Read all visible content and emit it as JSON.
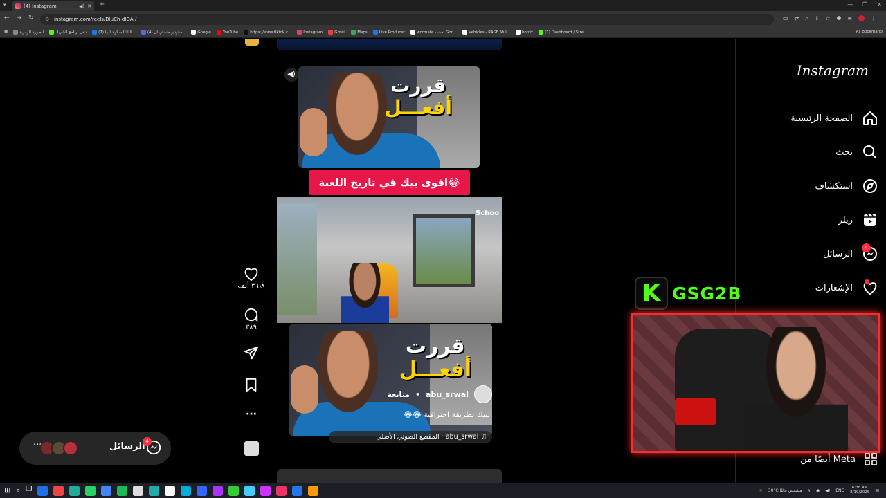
{
  "browser": {
    "tab_title": "(4) Instagram",
    "url": "instagram.com/reels/DluCh-dlQA-/",
    "bookmarks": [
      {
        "label": "الصورة الرمزية",
        "color": "#8a8a8a"
      },
      {
        "label": "دخل برنامج الشريك",
        "color": "#53fc18"
      },
      {
        "label": "(2) الباشا سكواد البيا...",
        "color": "#1877f2"
      },
      {
        "label": "(4) ستوديو منشئي ال...",
        "color": "#4a6cf7"
      },
      {
        "label": "Google",
        "color": "#ffffff"
      },
      {
        "label": "YouTube",
        "color": "#ff0000"
      },
      {
        "label": "https://www.tiktok.c...",
        "color": "#111111"
      },
      {
        "label": "Instagram",
        "color": "#e4405f"
      },
      {
        "label": "Gmail",
        "color": "#ea4335"
      },
      {
        "label": "Maps",
        "color": "#34a853"
      },
      {
        "label": "Live Producer",
        "color": "#1877f2"
      },
      {
        "label": "wormate - بحث Goo...",
        "color": "#ffffff"
      },
      {
        "label": "Vehicles - RAGE Mul...",
        "color": "#ffffff"
      },
      {
        "label": "botrix",
        "color": "#ffffff"
      },
      {
        "label": "(1) Dashboard / Stre...",
        "color": "#53fc18"
      }
    ],
    "all_bookmarks": "All Bookmarks"
  },
  "instagram": {
    "logo": "Instagram",
    "nav": [
      {
        "label": "الصفحة الرئيسية",
        "icon": "home-icon"
      },
      {
        "label": "بحث",
        "icon": "search-icon"
      },
      {
        "label": "استكشاف",
        "icon": "explore-icon"
      },
      {
        "label": "ريلز",
        "icon": "reels-icon"
      },
      {
        "label": "الرسائل",
        "icon": "messenger-icon",
        "badge": "4"
      },
      {
        "label": "الإشعارات",
        "icon": "heart-icon"
      }
    ],
    "meta_link": "أيضًا من Meta",
    "reel": {
      "thumb_title_line1": "قررت",
      "thumb_title_line2": "أفعـــل",
      "banner": "اقوى بيك في تاريخ اللعبة😂",
      "game_hud": "Schoo",
      "author": "abu_srwal",
      "follow": "متابعة",
      "separator": "•",
      "caption": "البيك بطريقة احترافية 😂😂",
      "audio": "abu_srwal · المقطع الصوتي الأصلي",
      "likes": "٣٦٫٨ ألف",
      "comments": "٣٨٩"
    },
    "messages_pill": {
      "label": "الرسائل",
      "badge": "4",
      "more": "···"
    }
  },
  "stream": {
    "brand_letter": "K",
    "brand_name": "GSG2B",
    "accent": "#53fc18",
    "frame_color": "#ff2a2a"
  },
  "taskbar": {
    "weather": "30°C مشمس غالبًا",
    "lang": "ENG",
    "time": "6:38 AM",
    "date": "8/19/2025"
  }
}
